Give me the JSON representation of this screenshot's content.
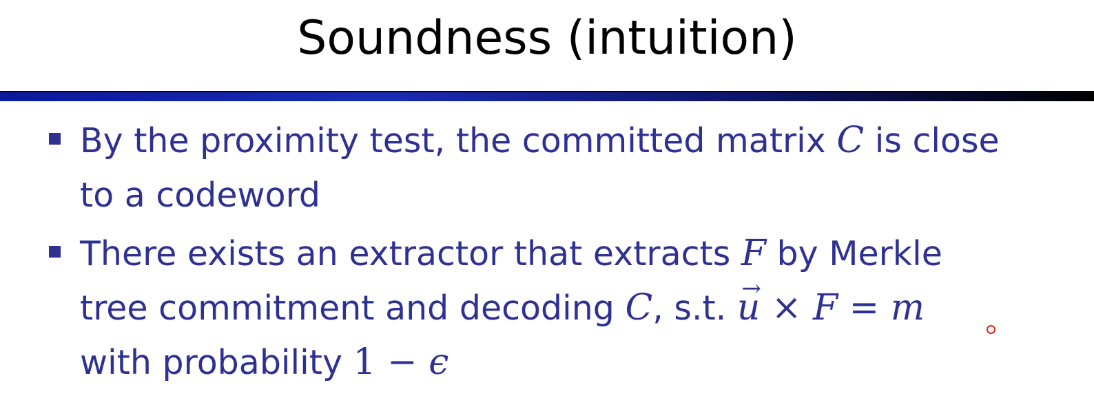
{
  "slide": {
    "title": "Soundness (intuition)",
    "bullets": [
      {
        "lines": [
          {
            "t1": "By the proximity test, the committed matrix ",
            "m1": "C",
            "t2": " is close"
          },
          {
            "t1": "to a codeword"
          }
        ]
      },
      {
        "lines": [
          {
            "t1": "There exists an extractor that extracts ",
            "m1": "F",
            "t2": " by Merkle"
          },
          {
            "t1": "tree commitment and decoding ",
            "m1": "C",
            "t2": ", s.t. ",
            "m2": "u",
            "m2_arrow": "→",
            "op1": " × ",
            "m3": "F",
            "op2": " = ",
            "m4": "m"
          },
          {
            "t1": "with probability ",
            "n1": "1",
            "op1": " − ",
            "m1": "ϵ"
          }
        ]
      }
    ]
  },
  "colors": {
    "text": "#2e3192",
    "title": "#000000",
    "rule": "#1a2bb5",
    "cursor": "#e2231a"
  },
  "icons": {
    "bullet": "square-bullet-icon",
    "cursor": "pointer-cursor-icon"
  }
}
